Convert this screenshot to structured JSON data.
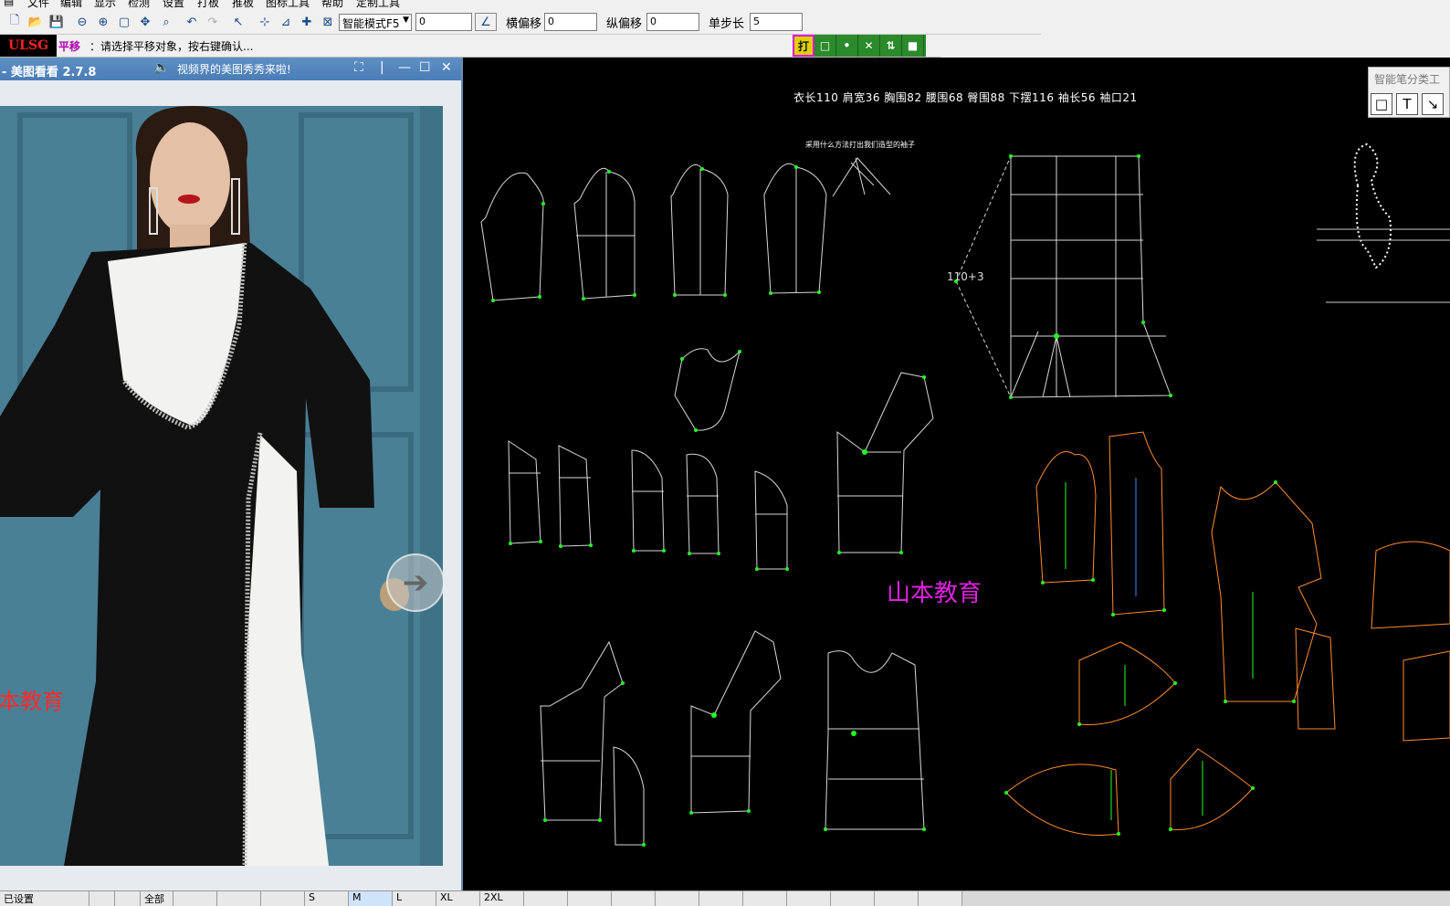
{
  "menubar": {
    "items": [
      "文件",
      "编辑",
      "显示",
      "检测",
      "设置",
      "打板",
      "推板",
      "图标工具",
      "帮助",
      "定制工具"
    ]
  },
  "toolbar": {
    "mode_select": "智能模式F5",
    "value_field": "0",
    "h_offset_label": "横偏移",
    "h_offset_value": "0",
    "v_offset_label": "纵偏移",
    "v_offset_value": "0",
    "step_label": "单步长",
    "step_value": "5"
  },
  "status": {
    "logo": "ULSG",
    "mode_name": "平移",
    "hint": "：请选择平移对象，按右键确认..."
  },
  "snap_tools": [
    {
      "icon": "打",
      "name": "snap-print-icon"
    },
    {
      "icon": "□",
      "name": "snap-rect-icon"
    },
    {
      "icon": "•",
      "name": "snap-point-icon"
    },
    {
      "icon": "✕",
      "name": "snap-cross-icon"
    },
    {
      "icon": "⇅",
      "name": "snap-move-icon"
    },
    {
      "icon": "■",
      "name": "snap-fill-icon"
    }
  ],
  "viewer": {
    "title": "- 美图看看 2.7.8",
    "promo": "视频界的美图秀秀来啦!",
    "watermark": "本教育"
  },
  "canvas": {
    "measurements": "衣长110   肩宽36   胸围82   腰围68   臀围88   下摆116   袖长56   袖口21",
    "title_note": "采用什么方法打出我们造型的袖子",
    "seam_note": "110+3",
    "watermark": "山本教育",
    "palette_title": "智能笔分类工",
    "palette_buttons": [
      "□",
      "T",
      "↘"
    ]
  },
  "tabs": [
    "已设置",
    "",
    "",
    "全部",
    "",
    "",
    "",
    "S",
    "M",
    "L",
    "XL",
    "2XL",
    "",
    "",
    "",
    "",
    "",
    "",
    "",
    "",
    "",
    ""
  ],
  "colors": {
    "pattern_line": "#d8d8d8",
    "node": "#22ff22",
    "seam_orange": "#ff8c2a",
    "accent_magenta": "#e020e0"
  }
}
